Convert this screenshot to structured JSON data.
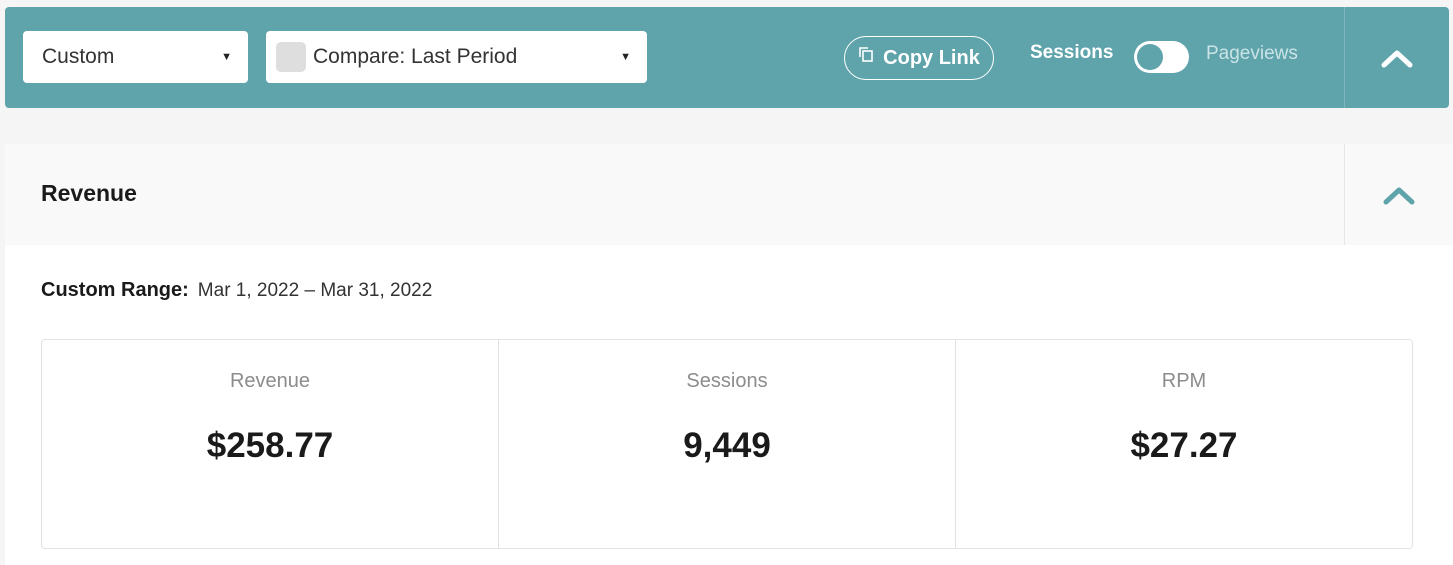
{
  "toolbar": {
    "range_select": "Custom",
    "compare_select": "Compare: Last Period",
    "copy_link": "Copy Link",
    "toggle_on_label": "Sessions",
    "toggle_off_label": "Pageviews",
    "accent_color": "#5fa3ab"
  },
  "revenue_card": {
    "title": "Revenue",
    "range_label": "Custom Range:",
    "range_value": "Mar 1, 2022 – Mar 31, 2022",
    "stats": [
      {
        "label": "Revenue",
        "value": "$258.77"
      },
      {
        "label": "Sessions",
        "value": "9,449"
      },
      {
        "label": "RPM",
        "value": "$27.27"
      }
    ]
  }
}
